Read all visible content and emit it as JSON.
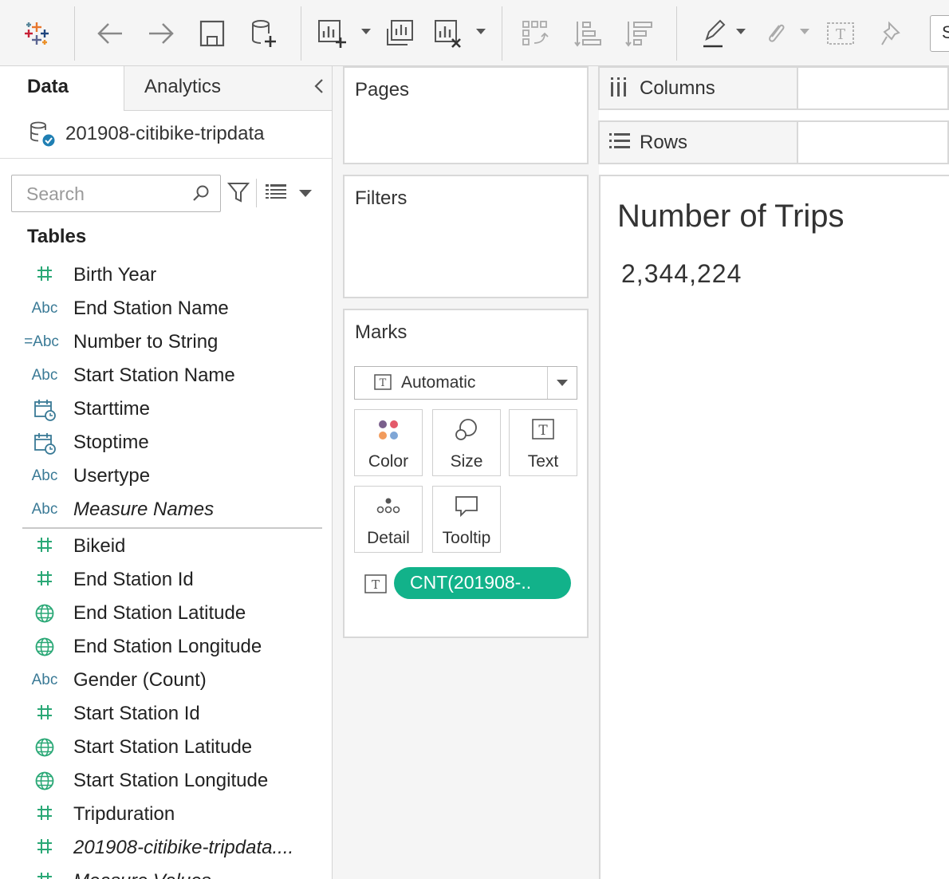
{
  "toolbar": {
    "search_stub": "S",
    "icons": [
      "tableau-logo-icon",
      "back-arrow-icon",
      "forward-arrow-icon",
      "save-icon",
      "new-datasource-icon",
      "new-worksheet-icon",
      "new-dashboard-icon",
      "clear-sheet-icon",
      "swap-rows-columns-icon",
      "sort-ascending-icon",
      "sort-descending-icon",
      "highlight-icon",
      "attach-icon",
      "label-icon",
      "pin-icon"
    ]
  },
  "data_pane": {
    "tab_data": "Data",
    "tab_analytics": "Analytics",
    "datasource_name": "201908-citibike-tripdata",
    "search_placeholder": "Search",
    "tables_label": "Tables",
    "dimensions": [
      {
        "icon": "#",
        "name": "Birth Year"
      },
      {
        "icon": "Abc",
        "name": "End Station Name"
      },
      {
        "icon": "=Abc",
        "name": "Number to String"
      },
      {
        "icon": "Abc",
        "name": "Start Station Name"
      },
      {
        "icon": "calendar",
        "name": "Starttime"
      },
      {
        "icon": "calendar",
        "name": "Stoptime"
      },
      {
        "icon": "Abc",
        "name": "Usertype"
      },
      {
        "icon": "Abc",
        "name": "Measure Names"
      }
    ],
    "measures": [
      {
        "icon": "#",
        "name": "Bikeid"
      },
      {
        "icon": "#",
        "name": "End Station Id"
      },
      {
        "icon": "globe",
        "name": "End Station Latitude"
      },
      {
        "icon": "globe",
        "name": "End Station Longitude"
      },
      {
        "icon": "Abc",
        "name": "Gender (Count)"
      },
      {
        "icon": "#",
        "name": "Start Station Id"
      },
      {
        "icon": "globe",
        "name": "Start Station Latitude"
      },
      {
        "icon": "globe",
        "name": "Start Station Longitude"
      },
      {
        "icon": "#",
        "name": "Tripduration"
      },
      {
        "icon": "#",
        "name": "201908-citibike-tripdata...."
      },
      {
        "icon": "#",
        "name": "Measure Values"
      }
    ]
  },
  "cards": {
    "pages": "Pages",
    "filters": "Filters",
    "marks": "Marks",
    "mark_type": "Automatic",
    "buttons": {
      "color": "Color",
      "size": "Size",
      "text": "Text",
      "detail": "Detail",
      "tooltip": "Tooltip"
    },
    "pill_label": "CNT(201908-.."
  },
  "shelves": {
    "columns": "Columns",
    "rows": "Rows"
  },
  "view": {
    "title": "Number of Trips",
    "value": "2,344,224"
  },
  "colors": {
    "pill": "#12b28a",
    "measure_icon": "#2aa876",
    "dimension_icon": "#3a7a96"
  }
}
